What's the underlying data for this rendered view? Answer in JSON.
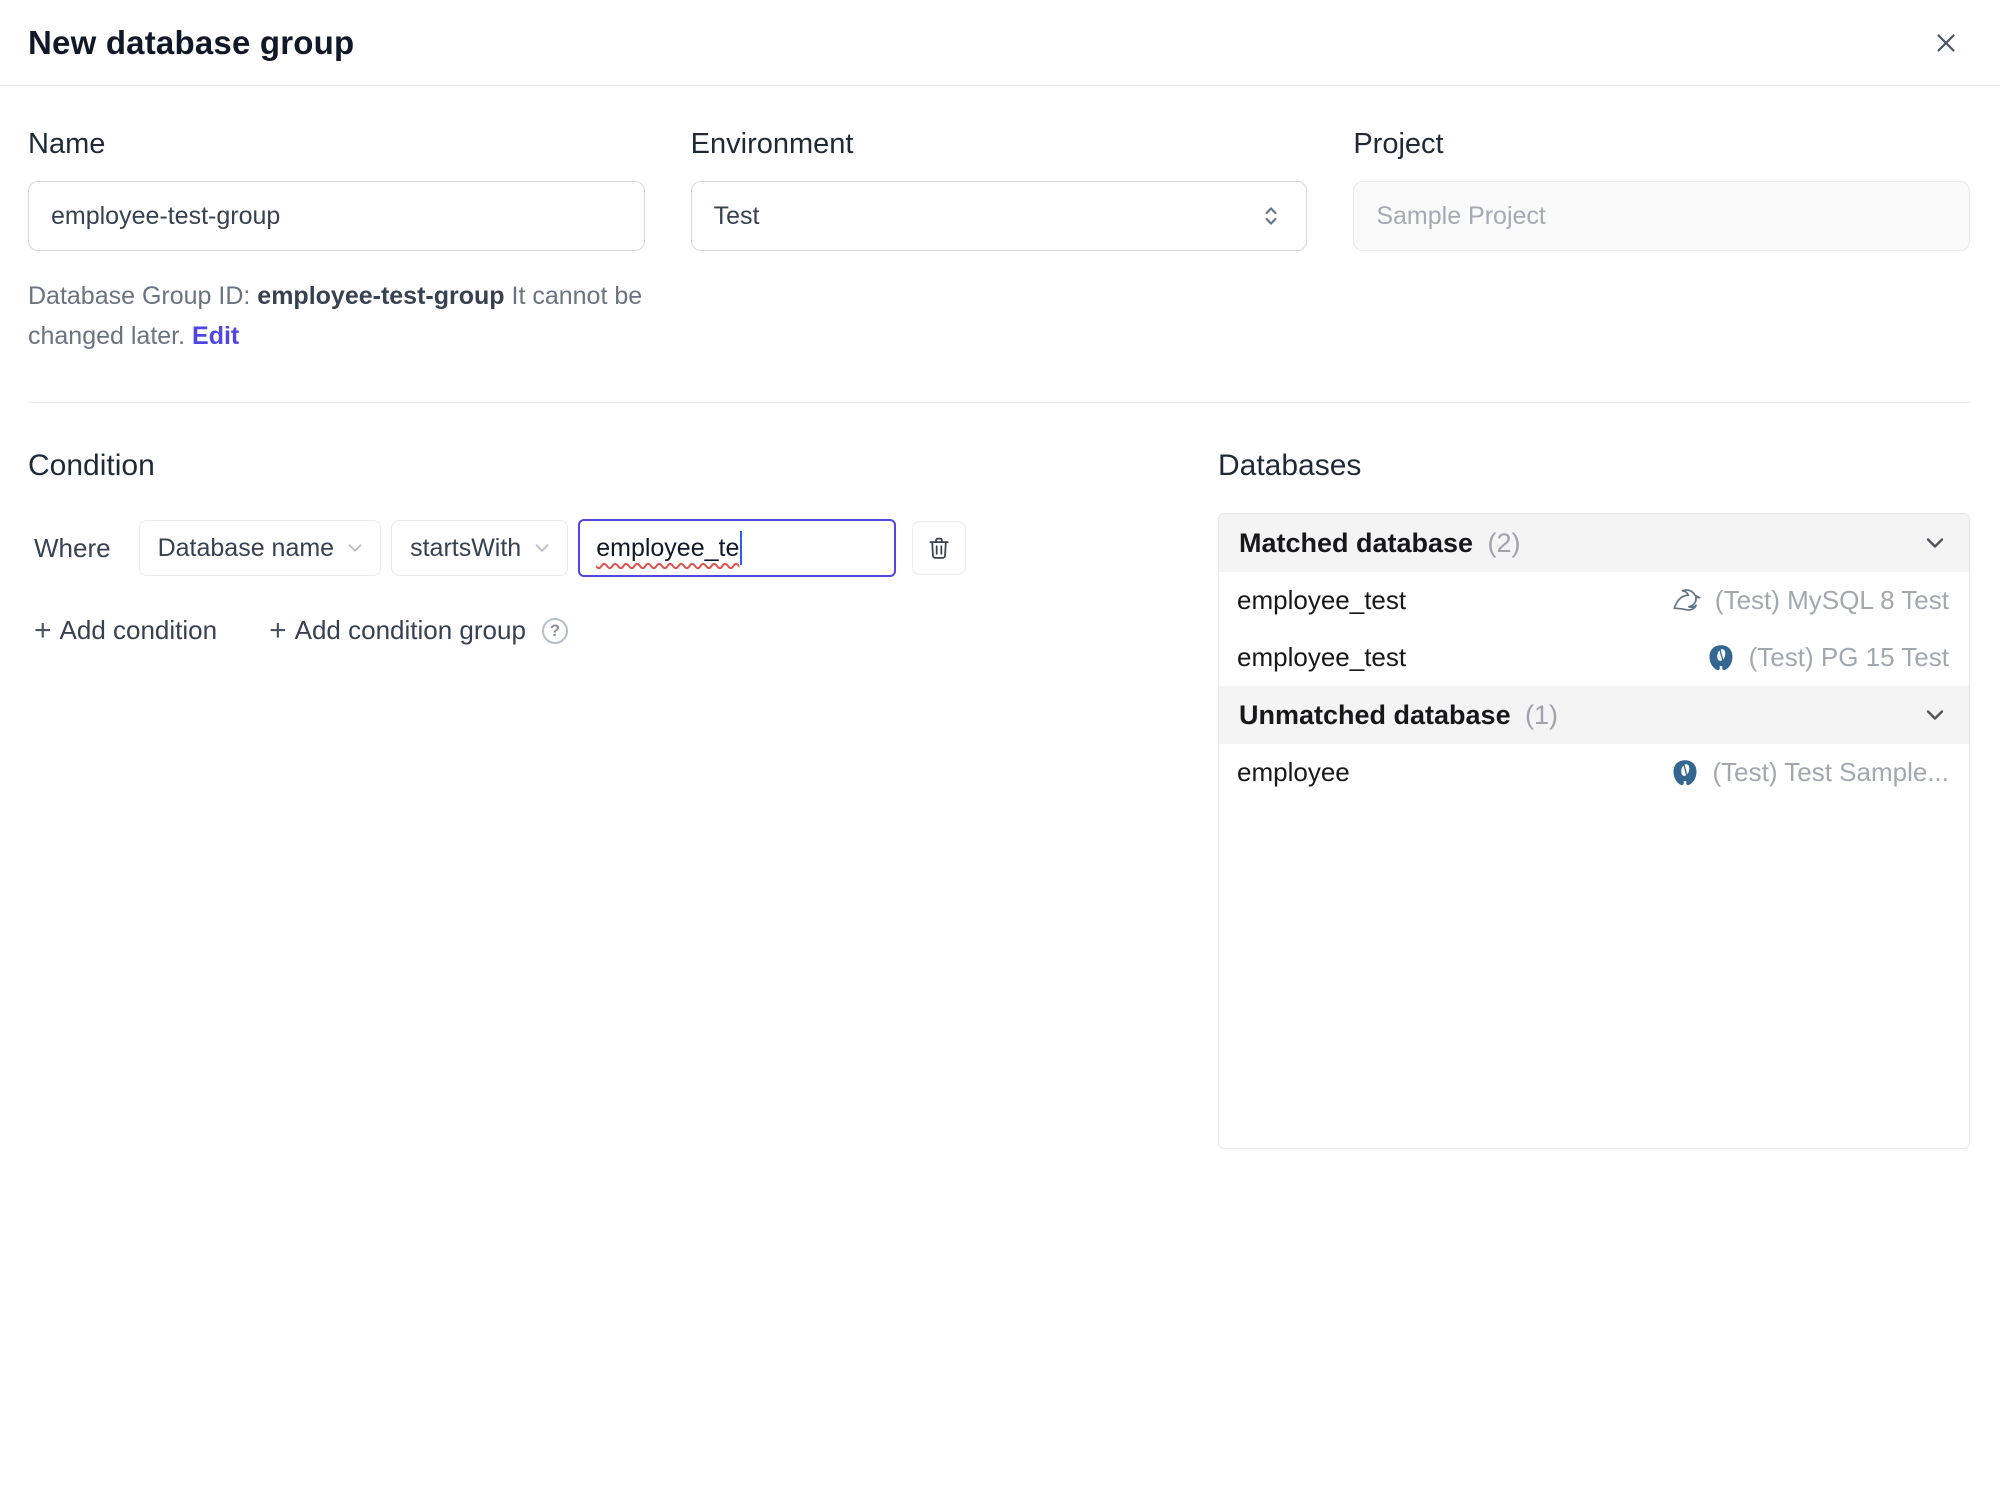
{
  "dialog": {
    "title": "New database group"
  },
  "form": {
    "name": {
      "label": "Name",
      "value": "employee-test-group"
    },
    "environment": {
      "label": "Environment",
      "value": "Test"
    },
    "project": {
      "label": "Project",
      "value": "Sample Project"
    },
    "group_id_note": {
      "prefix": "Database Group ID: ",
      "id": "employee-test-group",
      "suffix": " It cannot be changed later. ",
      "edit_label": "Edit"
    }
  },
  "condition": {
    "heading": "Condition",
    "where_label": "Where",
    "field_select_value": "Database name",
    "operator_select_value": "startsWith",
    "value_input": "employee_te",
    "add_condition_label": "Add condition",
    "add_condition_group_label": "Add condition group",
    "help_glyph": "?"
  },
  "databases": {
    "heading": "Databases",
    "groups": [
      {
        "title": "Matched database",
        "count_display": "(2)",
        "rows": [
          {
            "name": "employee_test",
            "engine": "mysql",
            "instance": "(Test) MySQL 8 Test"
          },
          {
            "name": "employee_test",
            "engine": "postgres",
            "instance": "(Test) PG 15 Test"
          }
        ]
      },
      {
        "title": "Unmatched database",
        "count_display": "(1)",
        "rows": [
          {
            "name": "employee",
            "engine": "postgres",
            "instance": "(Test) Test Sample..."
          }
        ]
      }
    ]
  },
  "colors": {
    "accent": "#4f46e5",
    "muted_text": "#9ca3af",
    "primary_text": "#1f2937",
    "postgres_blue": "#336791",
    "spellcheck_red": "#e05252"
  }
}
